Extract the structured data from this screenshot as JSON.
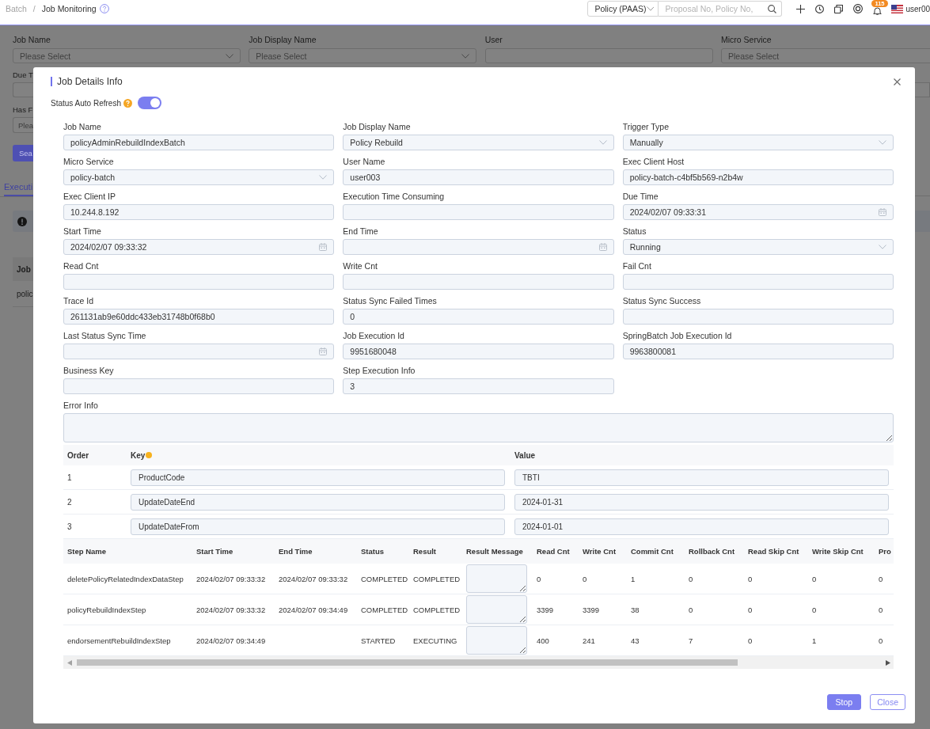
{
  "header": {
    "breadcrumb": [
      {
        "label": "Batch",
        "current": false
      },
      {
        "label": "Job Monitoring",
        "current": true
      }
    ],
    "separator": "/",
    "scope_select": "Policy (PAAS)",
    "search": {
      "placeholder": "Proposal No, Policy No,"
    },
    "notifications_badge": "115",
    "user": "user00"
  },
  "filters": [
    {
      "label": "Job Name",
      "kind": "select",
      "placeholder": "Please Select"
    },
    {
      "label": "Job Display Name",
      "kind": "select",
      "placeholder": "Please Select"
    },
    {
      "label": "User",
      "kind": "text"
    },
    {
      "label": "Micro Service",
      "kind": "select",
      "placeholder": "Please Select"
    }
  ],
  "partial_filters": [
    {
      "label": "Due T",
      "kind": "text"
    },
    {
      "label": "Has F",
      "kind": "select",
      "placeholder": "Plea"
    }
  ],
  "search_button": "Sea",
  "tabs": [
    {
      "label": "Executi",
      "selected": true
    }
  ],
  "table": {
    "columns": [
      "Job"
    ],
    "rows": [
      [
        "polic"
      ]
    ]
  },
  "modal": {
    "title": "Job Details Info",
    "auto_refresh": {
      "label": "Status Auto Refresh",
      "on": true
    },
    "fields": [
      {
        "label": "Job Name",
        "kind": "text",
        "value": "policyAdminRebuildIndexBatch"
      },
      {
        "label": "Job Display Name",
        "kind": "select",
        "value": "Policy Rebuild"
      },
      {
        "label": "Trigger Type",
        "kind": "select",
        "value": "Manually"
      },
      {
        "label": "Micro Service",
        "kind": "select",
        "value": "policy-batch"
      },
      {
        "label": "User Name",
        "kind": "text",
        "value": "user003"
      },
      {
        "label": "Exec Client Host",
        "kind": "text",
        "value": "policy-batch-c4bf5b569-n2b4w"
      },
      {
        "label": "Exec Client IP",
        "kind": "text",
        "value": "10.244.8.192"
      },
      {
        "label": "Execution Time Consuming",
        "kind": "text"
      },
      {
        "label": "Due Time",
        "kind": "date",
        "value": "2024/02/07 09:33:31"
      },
      {
        "label": "Start Time",
        "kind": "date",
        "value": "2024/02/07 09:33:32"
      },
      {
        "label": "End Time",
        "kind": "date"
      },
      {
        "label": "Status",
        "kind": "select",
        "value": "Running"
      },
      {
        "label": "Read Cnt",
        "kind": "text"
      },
      {
        "label": "Write Cnt",
        "kind": "text"
      },
      {
        "label": "Fail Cnt",
        "kind": "text"
      },
      {
        "label": "Trace Id",
        "kind": "text",
        "value": "261131ab9e60ddc433eb31748b0f68b0"
      },
      {
        "label": "Status Sync Failed Times",
        "kind": "text",
        "value": "0"
      },
      {
        "label": "Status Sync Success",
        "kind": "text"
      },
      {
        "label": "Last Status Sync Time",
        "kind": "date"
      },
      {
        "label": "Job Execution Id",
        "kind": "text",
        "value": "9951680048"
      },
      {
        "label": "SpringBatch Job Execution Id",
        "kind": "text",
        "value": "9963800081"
      },
      {
        "label": "Business Key",
        "kind": "text"
      },
      {
        "label": "Step Execution Info",
        "kind": "text",
        "value": "3"
      }
    ],
    "error_info": {
      "label": "Error Info"
    },
    "params": {
      "columns": [
        {
          "label": "Order",
          "required": false
        },
        {
          "label": "Key",
          "required": true
        },
        {
          "label": "Value",
          "required": false
        }
      ],
      "rows": [
        {
          "order": "1",
          "key": "ProductCode",
          "value": "TBTI"
        },
        {
          "order": "2",
          "key": "UpdateDateEnd",
          "value": "2024-01-31"
        },
        {
          "order": "3",
          "key": "UpdateDateFrom",
          "value": "2024-01-01"
        }
      ]
    },
    "steps": {
      "columns": [
        {
          "label": "Step Name",
          "kind": "text"
        },
        {
          "label": "Start Time",
          "kind": "text"
        },
        {
          "label": "End Time",
          "kind": "text"
        },
        {
          "label": "Status",
          "kind": "text"
        },
        {
          "label": "Result",
          "kind": "text"
        },
        {
          "label": "Result Message",
          "kind": "textarea"
        },
        {
          "label": "Read Cnt",
          "kind": "text"
        },
        {
          "label": "Write Cnt",
          "kind": "text"
        },
        {
          "label": "Commit Cnt",
          "kind": "text"
        },
        {
          "label": "Rollback Cnt",
          "kind": "text"
        },
        {
          "label": "Read Skip Cnt",
          "kind": "text"
        },
        {
          "label": "Write Skip Cnt",
          "kind": "text"
        },
        {
          "label": "Pro",
          "kind": "text"
        }
      ],
      "rows": [
        [
          "deletePolicyRelatedIndexDataStep",
          "2024/02/07 09:33:32",
          "2024/02/07 09:33:32",
          "COMPLETED",
          "COMPLETED",
          null,
          "0",
          "0",
          "1",
          "0",
          "0",
          "0",
          "0"
        ],
        [
          "policyRebuildIndexStep",
          "2024/02/07 09:33:32",
          "2024/02/07 09:34:49",
          "COMPLETED",
          "COMPLETED",
          null,
          "3399",
          "3399",
          "38",
          "0",
          "0",
          "0",
          "0"
        ],
        [
          "endorsementRebuildIndexStep",
          "2024/02/07 09:34:49",
          null,
          "STARTED",
          "EXECUTING",
          null,
          "400",
          "241",
          "43",
          "7",
          "0",
          "1",
          "0"
        ]
      ]
    },
    "buttons": [
      {
        "label": "Stop",
        "kind": "primary"
      },
      {
        "label": "Close",
        "kind": "secondary"
      }
    ]
  }
}
